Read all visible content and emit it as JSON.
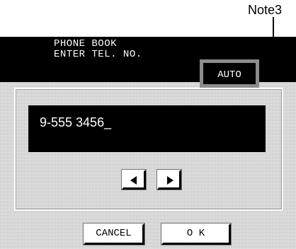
{
  "annotation": {
    "note_label": "Note3"
  },
  "header": {
    "title_line1": "PHONE BOOK",
    "title_line2": "ENTER TEL. NO.",
    "mode_badge": "AUTO"
  },
  "entry": {
    "value": "9-555 3456_"
  },
  "navigation": {
    "left_icon": "left-arrow-icon",
    "right_icon": "right-arrow-icon"
  },
  "buttons": {
    "cancel_label": "CANCEL",
    "ok_label": "O K"
  }
}
